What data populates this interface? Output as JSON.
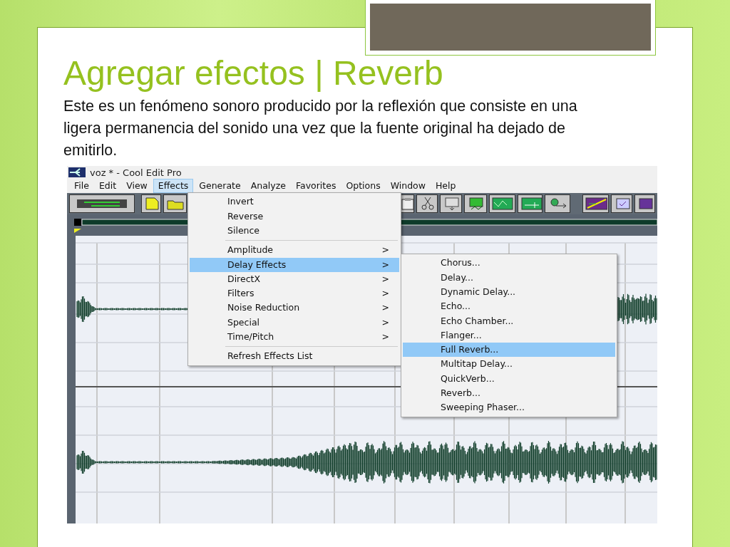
{
  "slide": {
    "title": "Agregar efectos | Reverb",
    "body": "Este es un fenómeno sonoro producido por la reflexión que consiste en una ligera permanencia del sonido una vez que la fuente original ha dejado de emitirlo."
  },
  "window": {
    "title": "voz * - Cool Edit Pro"
  },
  "menu_bar": [
    {
      "label": "File",
      "selected": false
    },
    {
      "label": "Edit",
      "selected": false
    },
    {
      "label": "View",
      "selected": false
    },
    {
      "label": "Effects",
      "selected": true
    },
    {
      "label": "Generate",
      "selected": false
    },
    {
      "label": "Analyze",
      "selected": false
    },
    {
      "label": "Favorites",
      "selected": false
    },
    {
      "label": "Options",
      "selected": false
    },
    {
      "label": "Window",
      "selected": false
    },
    {
      "label": "Help",
      "selected": false
    }
  ],
  "effects_menu": {
    "groups": [
      [
        {
          "label": "Invert",
          "selected": false
        },
        {
          "label": "Reverse",
          "selected": false
        },
        {
          "label": "Silence",
          "selected": false
        }
      ],
      [
        {
          "label": "Amplitude",
          "arrow": ">",
          "selected": false
        },
        {
          "label": "Delay Effects",
          "arrow": ">",
          "selected": true
        },
        {
          "label": "DirectX",
          "arrow": ">",
          "selected": false
        },
        {
          "label": "Filters",
          "arrow": ">",
          "selected": false
        },
        {
          "label": "Noise Reduction",
          "arrow": ">",
          "selected": false
        },
        {
          "label": "Special",
          "arrow": ">",
          "selected": false
        },
        {
          "label": "Time/Pitch",
          "arrow": ">",
          "selected": false
        }
      ],
      [
        {
          "label": "Refresh Effects List",
          "selected": false
        }
      ]
    ]
  },
  "delay_effects_submenu": [
    {
      "label": "Chorus...",
      "selected": false
    },
    {
      "label": "Delay...",
      "selected": false
    },
    {
      "label": "Dynamic Delay...",
      "selected": false
    },
    {
      "label": "Echo...",
      "selected": false
    },
    {
      "label": "Echo Chamber...",
      "selected": false
    },
    {
      "label": "Flanger...",
      "selected": false
    },
    {
      "label": "Full Reverb...",
      "selected": true
    },
    {
      "label": "Multitap Delay...",
      "selected": false
    },
    {
      "label": "QuickVerb...",
      "selected": false
    },
    {
      "label": "Reverb...",
      "selected": false
    },
    {
      "label": "Sweeping Phaser...",
      "selected": false
    }
  ]
}
